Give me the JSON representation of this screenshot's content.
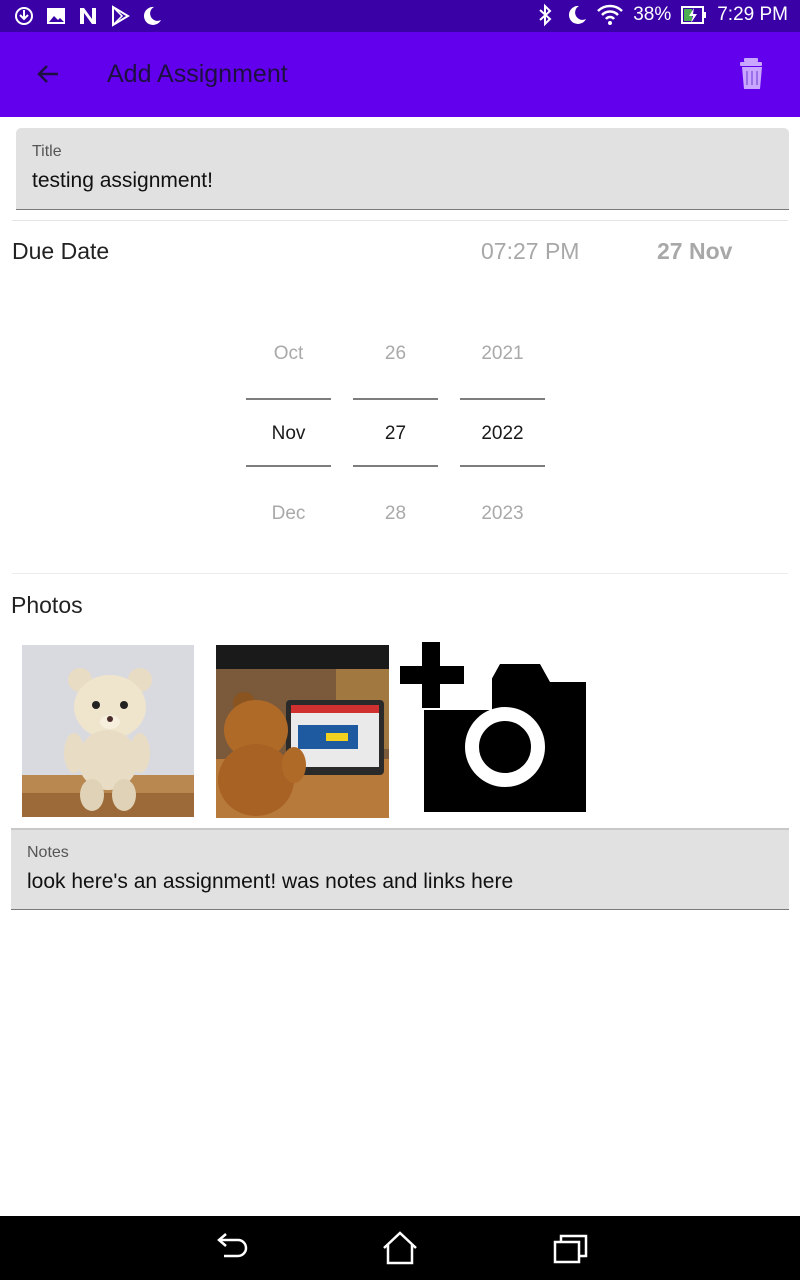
{
  "status_bar": {
    "battery_percent": "38%",
    "time": "7:29 PM",
    "left_icons": [
      "download-icon",
      "image-icon",
      "n-app-icon",
      "play-store-icon",
      "moon-icon"
    ],
    "right_icons": [
      "bluetooth-icon",
      "moon-icon",
      "wifi-icon",
      "battery-charging-icon"
    ]
  },
  "app_bar": {
    "title": "Add Assignment",
    "back_icon": "arrow-back-icon",
    "delete_icon": "trash-icon",
    "background": "#6200ee"
  },
  "title_field": {
    "label": "Title",
    "value": "testing assignment!"
  },
  "due_date": {
    "label": "Due Date",
    "time": "07:27 PM",
    "date": "27 Nov"
  },
  "date_picker": {
    "month": {
      "prev": "Oct",
      "selected": "Nov",
      "next": "Dec"
    },
    "day": {
      "prev": "26",
      "selected": "27",
      "next": "28"
    },
    "year": {
      "prev": "2021",
      "selected": "2022",
      "next": "2023"
    }
  },
  "photos": {
    "label": "Photos",
    "items": [
      "teddy-bear-photo",
      "teddy-bear-tablet-photo"
    ],
    "add_icon": "add-photo-camera-icon"
  },
  "notes_field": {
    "label": "Notes",
    "value": "look here's an assignment! was notes and links here"
  },
  "nav_bar": {
    "icons": [
      "back-nav-icon",
      "home-nav-icon",
      "recents-nav-icon"
    ]
  }
}
